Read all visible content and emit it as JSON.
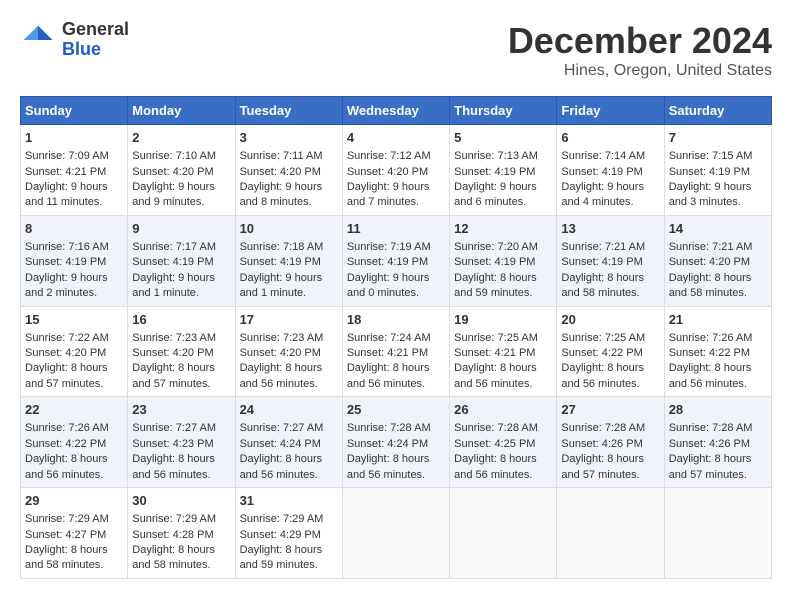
{
  "logo": {
    "general": "General",
    "blue": "Blue"
  },
  "title": "December 2024",
  "subtitle": "Hines, Oregon, United States",
  "days_header": [
    "Sunday",
    "Monday",
    "Tuesday",
    "Wednesday",
    "Thursday",
    "Friday",
    "Saturday"
  ],
  "weeks": [
    [
      {
        "day": "1",
        "sunrise": "Sunrise: 7:09 AM",
        "sunset": "Sunset: 4:21 PM",
        "daylight": "Daylight: 9 hours and 11 minutes."
      },
      {
        "day": "2",
        "sunrise": "Sunrise: 7:10 AM",
        "sunset": "Sunset: 4:20 PM",
        "daylight": "Daylight: 9 hours and 9 minutes."
      },
      {
        "day": "3",
        "sunrise": "Sunrise: 7:11 AM",
        "sunset": "Sunset: 4:20 PM",
        "daylight": "Daylight: 9 hours and 8 minutes."
      },
      {
        "day": "4",
        "sunrise": "Sunrise: 7:12 AM",
        "sunset": "Sunset: 4:20 PM",
        "daylight": "Daylight: 9 hours and 7 minutes."
      },
      {
        "day": "5",
        "sunrise": "Sunrise: 7:13 AM",
        "sunset": "Sunset: 4:19 PM",
        "daylight": "Daylight: 9 hours and 6 minutes."
      },
      {
        "day": "6",
        "sunrise": "Sunrise: 7:14 AM",
        "sunset": "Sunset: 4:19 PM",
        "daylight": "Daylight: 9 hours and 4 minutes."
      },
      {
        "day": "7",
        "sunrise": "Sunrise: 7:15 AM",
        "sunset": "Sunset: 4:19 PM",
        "daylight": "Daylight: 9 hours and 3 minutes."
      }
    ],
    [
      {
        "day": "8",
        "sunrise": "Sunrise: 7:16 AM",
        "sunset": "Sunset: 4:19 PM",
        "daylight": "Daylight: 9 hours and 2 minutes."
      },
      {
        "day": "9",
        "sunrise": "Sunrise: 7:17 AM",
        "sunset": "Sunset: 4:19 PM",
        "daylight": "Daylight: 9 hours and 1 minute."
      },
      {
        "day": "10",
        "sunrise": "Sunrise: 7:18 AM",
        "sunset": "Sunset: 4:19 PM",
        "daylight": "Daylight: 9 hours and 1 minute."
      },
      {
        "day": "11",
        "sunrise": "Sunrise: 7:19 AM",
        "sunset": "Sunset: 4:19 PM",
        "daylight": "Daylight: 9 hours and 0 minutes."
      },
      {
        "day": "12",
        "sunrise": "Sunrise: 7:20 AM",
        "sunset": "Sunset: 4:19 PM",
        "daylight": "Daylight: 8 hours and 59 minutes."
      },
      {
        "day": "13",
        "sunrise": "Sunrise: 7:21 AM",
        "sunset": "Sunset: 4:19 PM",
        "daylight": "Daylight: 8 hours and 58 minutes."
      },
      {
        "day": "14",
        "sunrise": "Sunrise: 7:21 AM",
        "sunset": "Sunset: 4:20 PM",
        "daylight": "Daylight: 8 hours and 58 minutes."
      }
    ],
    [
      {
        "day": "15",
        "sunrise": "Sunrise: 7:22 AM",
        "sunset": "Sunset: 4:20 PM",
        "daylight": "Daylight: 8 hours and 57 minutes."
      },
      {
        "day": "16",
        "sunrise": "Sunrise: 7:23 AM",
        "sunset": "Sunset: 4:20 PM",
        "daylight": "Daylight: 8 hours and 57 minutes."
      },
      {
        "day": "17",
        "sunrise": "Sunrise: 7:23 AM",
        "sunset": "Sunset: 4:20 PM",
        "daylight": "Daylight: 8 hours and 56 minutes."
      },
      {
        "day": "18",
        "sunrise": "Sunrise: 7:24 AM",
        "sunset": "Sunset: 4:21 PM",
        "daylight": "Daylight: 8 hours and 56 minutes."
      },
      {
        "day": "19",
        "sunrise": "Sunrise: 7:25 AM",
        "sunset": "Sunset: 4:21 PM",
        "daylight": "Daylight: 8 hours and 56 minutes."
      },
      {
        "day": "20",
        "sunrise": "Sunrise: 7:25 AM",
        "sunset": "Sunset: 4:22 PM",
        "daylight": "Daylight: 8 hours and 56 minutes."
      },
      {
        "day": "21",
        "sunrise": "Sunrise: 7:26 AM",
        "sunset": "Sunset: 4:22 PM",
        "daylight": "Daylight: 8 hours and 56 minutes."
      }
    ],
    [
      {
        "day": "22",
        "sunrise": "Sunrise: 7:26 AM",
        "sunset": "Sunset: 4:22 PM",
        "daylight": "Daylight: 8 hours and 56 minutes."
      },
      {
        "day": "23",
        "sunrise": "Sunrise: 7:27 AM",
        "sunset": "Sunset: 4:23 PM",
        "daylight": "Daylight: 8 hours and 56 minutes."
      },
      {
        "day": "24",
        "sunrise": "Sunrise: 7:27 AM",
        "sunset": "Sunset: 4:24 PM",
        "daylight": "Daylight: 8 hours and 56 minutes."
      },
      {
        "day": "25",
        "sunrise": "Sunrise: 7:28 AM",
        "sunset": "Sunset: 4:24 PM",
        "daylight": "Daylight: 8 hours and 56 minutes."
      },
      {
        "day": "26",
        "sunrise": "Sunrise: 7:28 AM",
        "sunset": "Sunset: 4:25 PM",
        "daylight": "Daylight: 8 hours and 56 minutes."
      },
      {
        "day": "27",
        "sunrise": "Sunrise: 7:28 AM",
        "sunset": "Sunset: 4:26 PM",
        "daylight": "Daylight: 8 hours and 57 minutes."
      },
      {
        "day": "28",
        "sunrise": "Sunrise: 7:28 AM",
        "sunset": "Sunset: 4:26 PM",
        "daylight": "Daylight: 8 hours and 57 minutes."
      }
    ],
    [
      {
        "day": "29",
        "sunrise": "Sunrise: 7:29 AM",
        "sunset": "Sunset: 4:27 PM",
        "daylight": "Daylight: 8 hours and 58 minutes."
      },
      {
        "day": "30",
        "sunrise": "Sunrise: 7:29 AM",
        "sunset": "Sunset: 4:28 PM",
        "daylight": "Daylight: 8 hours and 58 minutes."
      },
      {
        "day": "31",
        "sunrise": "Sunrise: 7:29 AM",
        "sunset": "Sunset: 4:29 PM",
        "daylight": "Daylight: 8 hours and 59 minutes."
      },
      null,
      null,
      null,
      null
    ]
  ]
}
